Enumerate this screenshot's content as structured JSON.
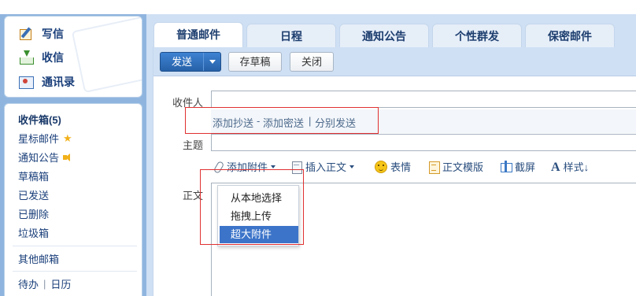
{
  "sidebar": {
    "quick": {
      "write": "写信",
      "inbox": "收信",
      "contacts": "通讯录"
    },
    "folders": {
      "inbox": "收件箱(5)",
      "starred": "星标邮件",
      "notices": "通知公告",
      "drafts": "草稿箱",
      "sent": "已发送",
      "deleted": "已删除",
      "trash": "垃圾箱",
      "other": "其他邮箱",
      "todo": "待办",
      "calendar_sep": "|",
      "calendar": "日历"
    }
  },
  "tabs": [
    "普通邮件",
    "日程",
    "通知公告",
    "个性群发",
    "保密邮件"
  ],
  "toolbar": {
    "send": "发送",
    "draft": "存草稿",
    "close": "关闭"
  },
  "compose": {
    "to_label": "收件人",
    "add_cc": "添加抄送",
    "sep1": "-",
    "add_bcc": "添加密送",
    "sep2": "|",
    "separate_send": "分别发送",
    "subject_label": "主题",
    "body_label": "正文",
    "attach": {
      "add_attachment": "添加附件",
      "insert_body": "插入正文",
      "emoji": "表情",
      "body_template": "正文模版",
      "screenshot": "截屏",
      "style": "样式↓"
    }
  },
  "attach_menu": {
    "items": [
      "从本地选择",
      "拖拽上传",
      "超大附件"
    ],
    "selected_index": 2
  },
  "colors": {
    "accent": "#3c74c9",
    "highlight_box": "#e03030",
    "background": "#cfe0f4"
  }
}
